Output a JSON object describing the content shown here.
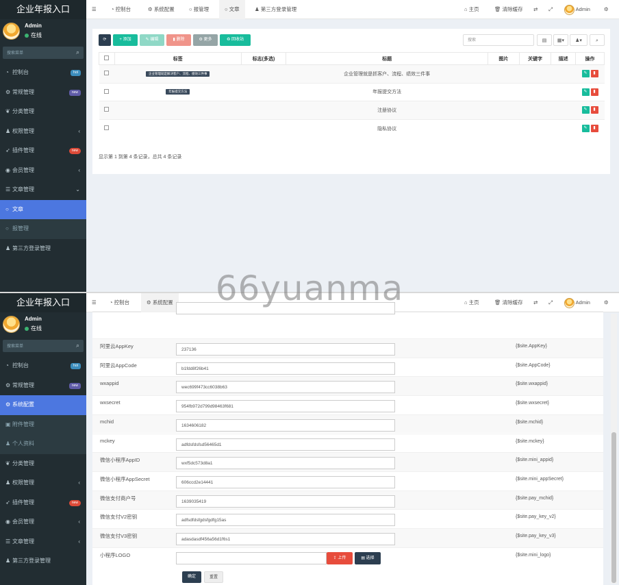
{
  "app": {
    "title": "企业年报入口"
  },
  "user": {
    "name": "Admin",
    "status": "在线"
  },
  "sidebar_search": {
    "placeholder": "搜索菜单"
  },
  "colors": {
    "sidebar_bg": "#222d32",
    "active": "#4c77e0",
    "success": "#18bc9c",
    "danger": "#e74c3c",
    "primary_dark": "#2c3e50"
  },
  "badges": {
    "hot": "hot",
    "new": "new"
  },
  "top": {
    "menu_icon": "hamburger-icon",
    "home": "主页",
    "clear_cache": "清除缓存",
    "user": "Admin",
    "settings_icon": "gear-icon",
    "fullscreen_icon": "expand-icon",
    "translate_icon": "translate-icon"
  },
  "panel1": {
    "tabs": [
      "控制台",
      "系统配置",
      "报管理",
      "文章",
      "第三方登录管理"
    ],
    "menu": [
      "控制台",
      "常规管理",
      "分类管理",
      "权限管理",
      "插件管理",
      "会员管理",
      "文章管理",
      "文章",
      "报管理",
      "第三方登录管理"
    ],
    "toolbar": {
      "add": "添加",
      "edit": "编辑",
      "delete": "删除",
      "more": "更多",
      "recycle": "回收站",
      "search_placeholder": "搜索"
    },
    "table": {
      "headers": [
        "标签",
        "标志(多选)",
        "标题",
        "图片",
        "关键字",
        "描述",
        "操作"
      ],
      "rows": [
        {
          "tag": "企业管理就是解决客户、流程、绩效三件事",
          "title": "企业管理就是抓客户、流程、绩效三件事"
        },
        {
          "tag": "年报提交方法",
          "title": "年报提交方法"
        },
        {
          "tag": "",
          "title": "注册协议"
        },
        {
          "tag": "",
          "title": "隐私协议"
        }
      ]
    },
    "pagination": "显示第 1 到第 4 条记录，总共 4 条记录"
  },
  "panel2": {
    "tabs": [
      "控制台",
      "系统配置"
    ],
    "menu": [
      "控制台",
      "常规管理",
      "系统配置",
      "附件管理",
      "个人资料",
      "分类管理",
      "权限管理",
      "插件管理",
      "会员管理",
      "文章管理",
      "第三方登录管理"
    ],
    "fields": [
      {
        "label": "阿里云AppKey",
        "value": "237136",
        "note": "{$site.AppKey}"
      },
      {
        "label": "阿里云AppCode",
        "value": "b1fdd8f26b41",
        "note": "{$site.AppCode}"
      },
      {
        "label": "wxappid",
        "value": "wec699f473cc6038b63",
        "note": "{$site.wxappid}"
      },
      {
        "label": "wxsecret",
        "value": "954fb972d799d98463f681",
        "note": "{$site.wxsecret}"
      },
      {
        "label": "mchid",
        "value": "1634606182",
        "note": "{$site.mchid}"
      },
      {
        "label": "mckey",
        "value": "adfdsfdsfsd56465d1",
        "note": "{$site.mckey}"
      },
      {
        "label": "微信小程序AppID",
        "value": "wxf5dc573d8a1",
        "note": "{$site.mini_appid}"
      },
      {
        "label": "微信小程序AppSecret",
        "value": "606ccd2e14441",
        "note": "{$site.mini_appSecret}"
      },
      {
        "label": "微信支付商户号",
        "value": "1639035419",
        "note": "{$site.pay_mchid}"
      },
      {
        "label": "微信支付V2密钥",
        "value": "adfsdfdsfgdsfgdfg15as",
        "note": "{$site.pay_key_v2}"
      },
      {
        "label": "微信支付V3密钥",
        "value": "adasdasdf456a56d1f6s1",
        "note": "{$site.pay_key_v3}"
      },
      {
        "label": "小程序LOGO",
        "value": "",
        "note": "{$site.mini_logo}"
      }
    ],
    "upload": "上传",
    "choose": "选择",
    "submit": "确定",
    "reset": "重置"
  },
  "watermark": "66yuanma"
}
